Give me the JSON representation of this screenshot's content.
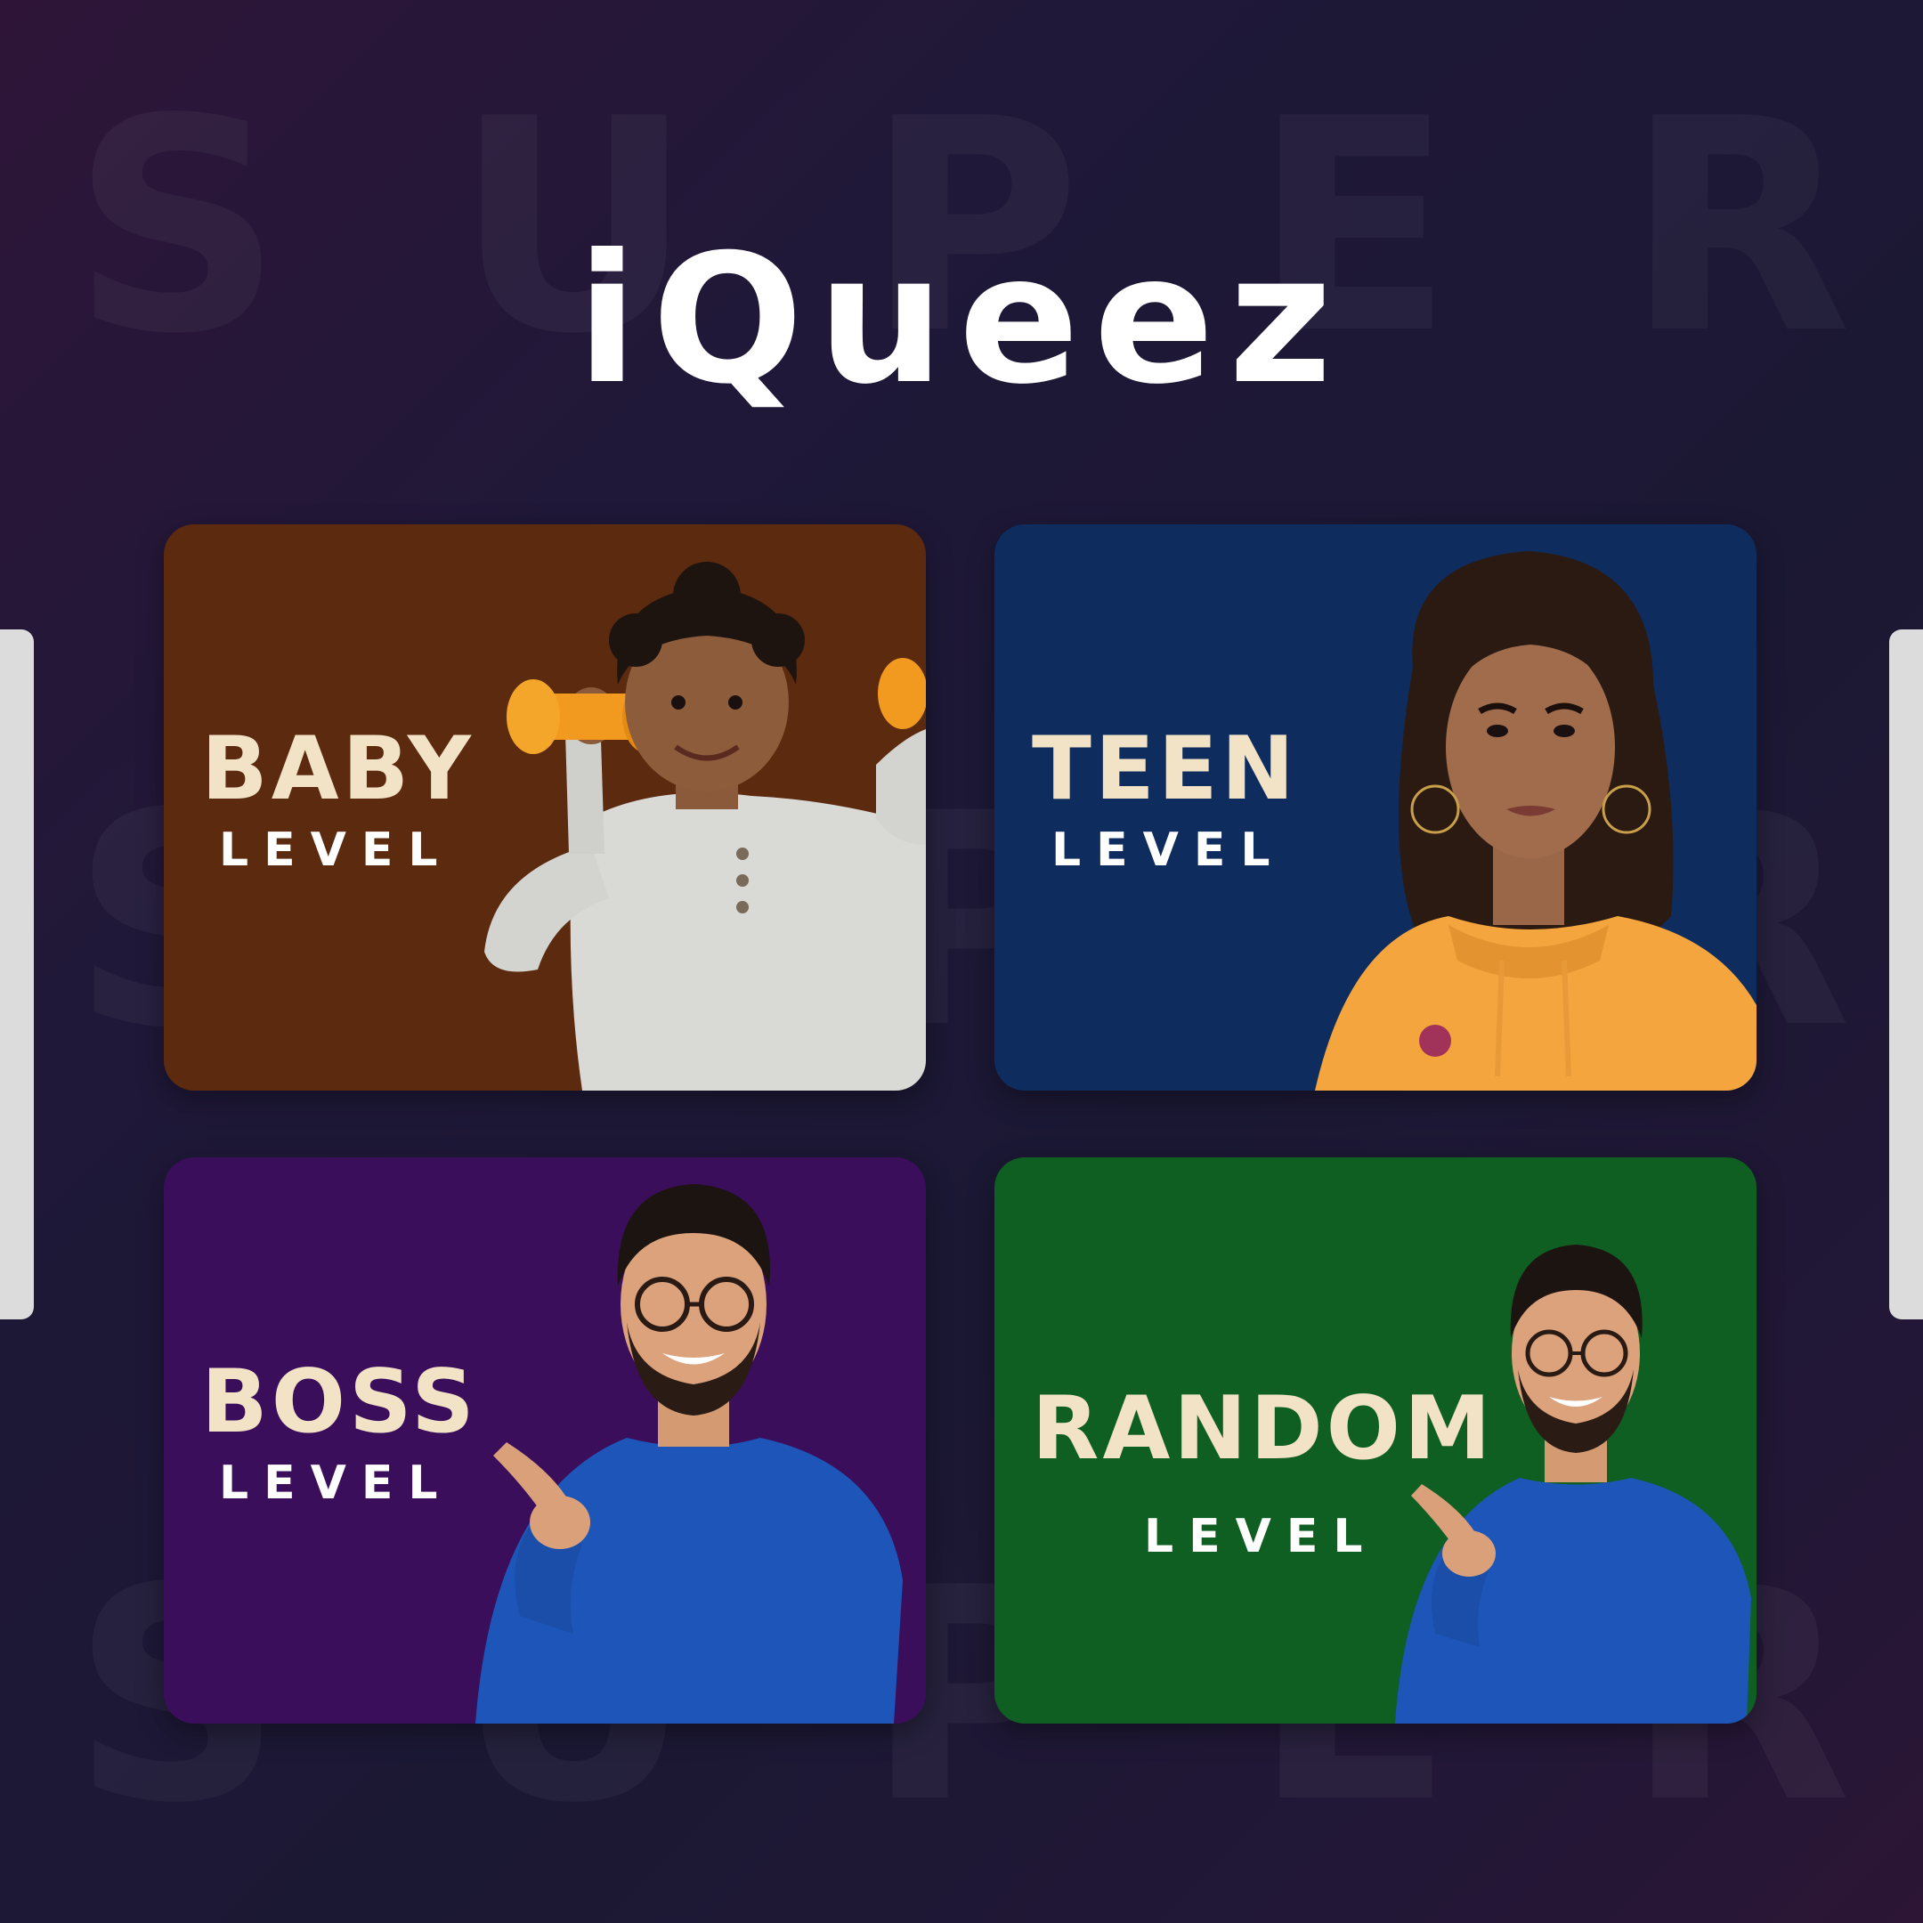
{
  "app": {
    "title": "iQueez"
  },
  "background_text": {
    "letters": [
      "S",
      "U",
      "P",
      "E",
      "R"
    ]
  },
  "cards": [
    {
      "title": "BABY",
      "subtitle": "LEVEL",
      "bg": "#5b2a0f",
      "image": "child-with-dumbbells-photo"
    },
    {
      "title": "TEEN",
      "subtitle": "LEVEL",
      "bg": "#0f2c5e",
      "image": "young-woman-orange-hoodie-photo"
    },
    {
      "title": "BOSS",
      "subtitle": "LEVEL",
      "bg": "#3a0e5a",
      "image": "man-blue-sweater-pointing-photo"
    },
    {
      "title": "RANDOM",
      "subtitle": "LEVEL",
      "bg": "#0f5e22",
      "image": "man-blue-sweater-pointing-photo"
    }
  ],
  "colors": {
    "title_text": "#f2e3c6",
    "subtitle_text": "#ffffff",
    "side_tabs": "#dcdcdc"
  }
}
